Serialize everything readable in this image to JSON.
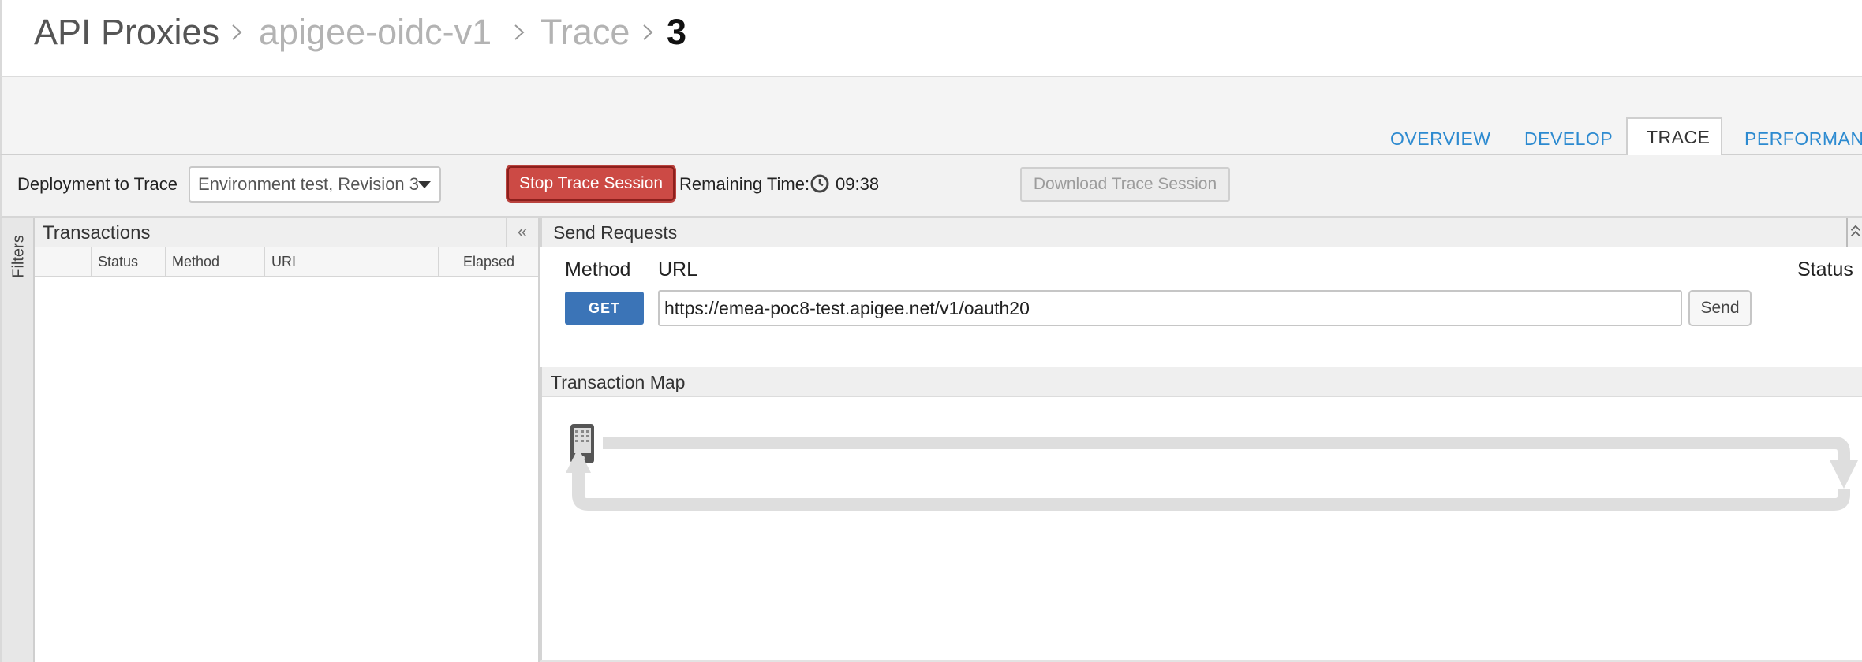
{
  "breadcrumb": {
    "items": [
      "API Proxies",
      "apigee-oidc-v1",
      "Trace",
      "3"
    ]
  },
  "tabs": [
    {
      "label": "OVERVIEW",
      "active": false
    },
    {
      "label": "DEVELOP",
      "active": false
    },
    {
      "label": "TRACE",
      "active": true
    },
    {
      "label": "PERFORMANC",
      "active": false
    }
  ],
  "toolbar": {
    "deployment_label": "Deployment to Trace",
    "deployment_value": "Environment test, Revision 3",
    "stop_button": "Stop Trace Session",
    "remaining_label": "Remaining Time:",
    "remaining_value": "09:38",
    "download_button": "Download Trace Session"
  },
  "filters": {
    "label": "Filters"
  },
  "transactions": {
    "title": "Transactions",
    "collapse_glyph": "«",
    "columns": [
      "",
      "Status",
      "Method",
      "URI",
      "Elapsed"
    ],
    "rows": []
  },
  "send_requests": {
    "title": "Send Requests",
    "method_label": "Method",
    "url_label": "URL",
    "status_label": "Status",
    "method_value": "GET",
    "url_value": "https://emea-poc8-test.apigee.net/v1/oauth20",
    "send_button": "Send"
  },
  "transaction_map": {
    "title": "Transaction Map",
    "client_icon": "mobile-phone-icon"
  },
  "colors": {
    "tab_link": "#2c8ad0",
    "stop_button": "#cc4a45",
    "get_button": "#3b74b7",
    "map_flow": "#dedede"
  }
}
